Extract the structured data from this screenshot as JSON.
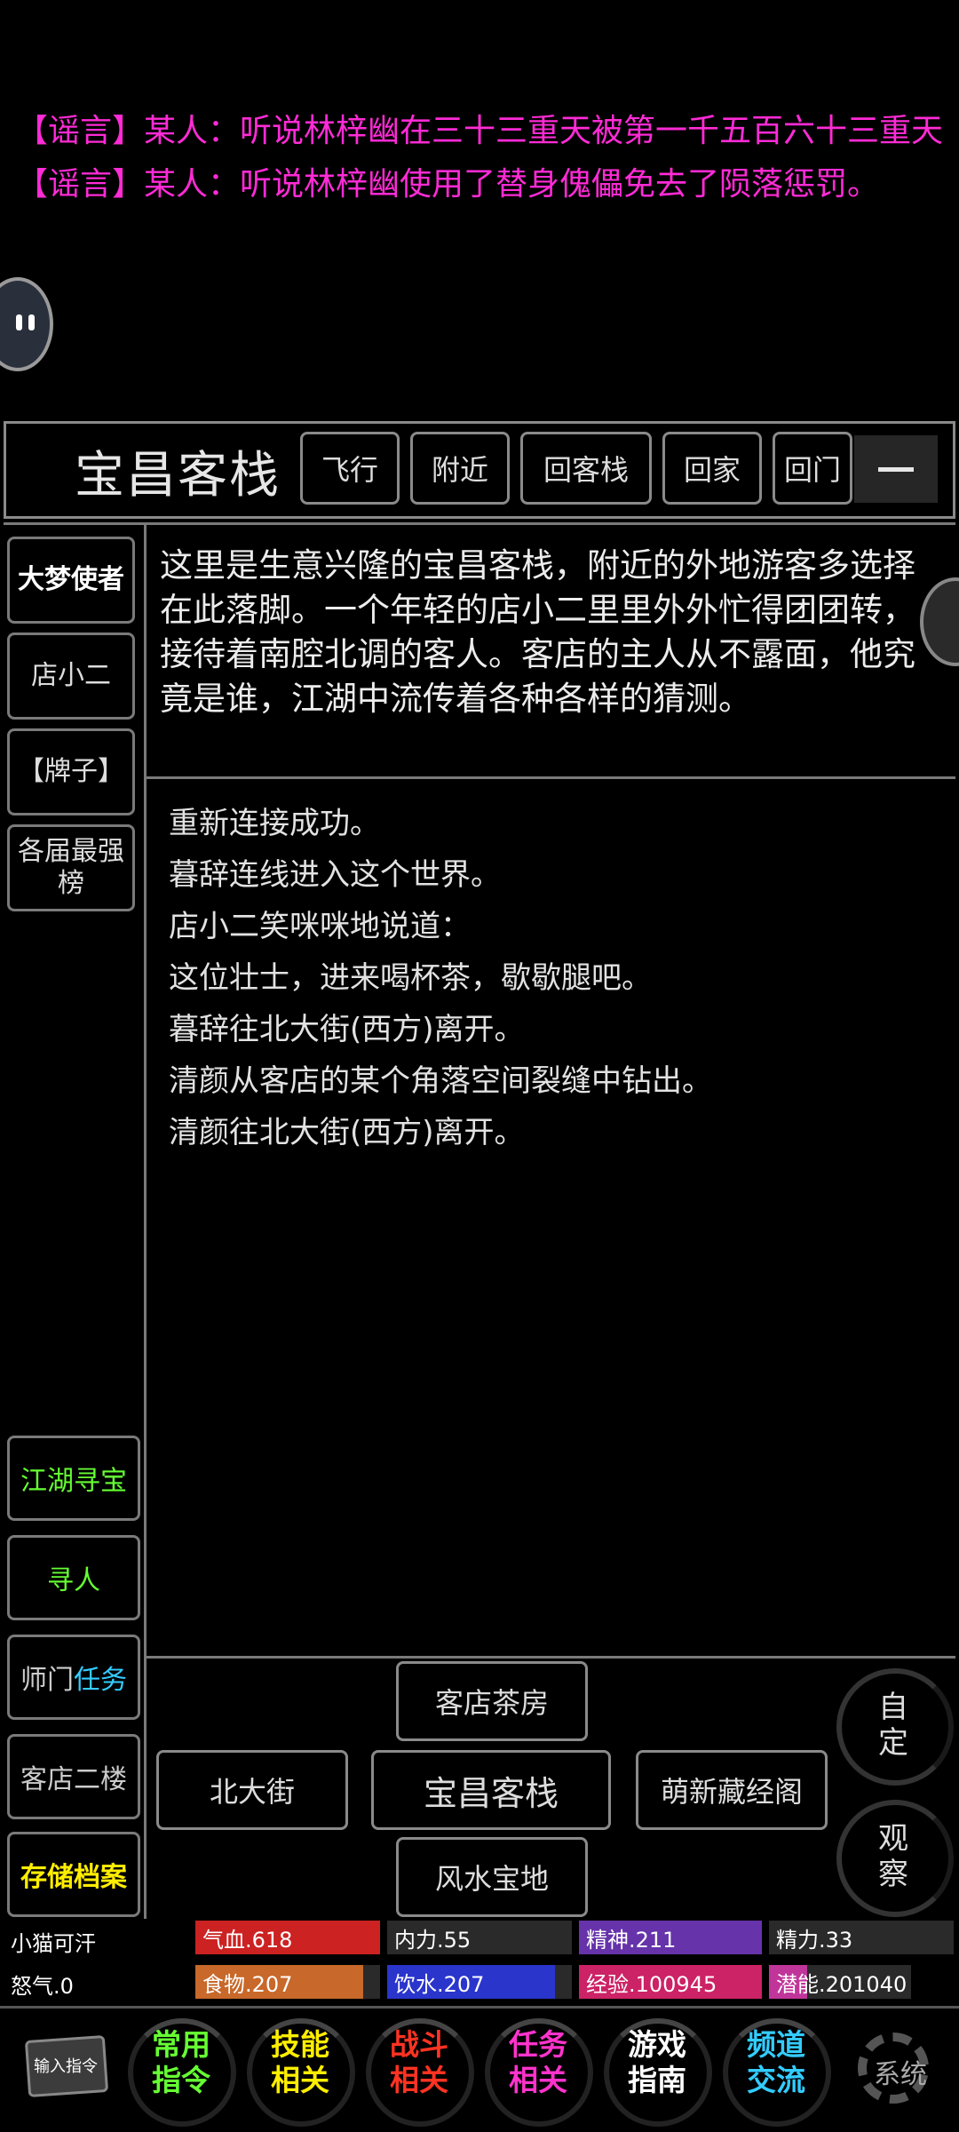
{
  "rumors": [
    "【谣言】某人：听说林梓幽在三十三重天被第一千五百六十三重天",
    "【谣言】某人：听说林梓幽使用了替身傀儡免去了陨落惩罚。"
  ],
  "topbar": {
    "room_title": "宝昌客栈",
    "buttons": [
      "飞行",
      "附近",
      "回客栈",
      "回家",
      "回门"
    ]
  },
  "npcs": [
    "大梦使者",
    "店小二",
    "【牌子】",
    "各届最强榜"
  ],
  "functions": [
    {
      "label": "江湖寻宝",
      "color": "#66ff33"
    },
    {
      "label": "寻人",
      "color": "#66ff33"
    },
    {
      "label_a": "师门",
      "label_b": "任务",
      "color": "#cccccc",
      "color_b": "#33ccff"
    },
    {
      "label": "客店二楼",
      "color": "#cccccc"
    },
    {
      "label": "存储档案",
      "color": "#ffee00"
    }
  ],
  "room_description": "这里是生意兴隆的宝昌客栈，附近的外地游客多选择在此落脚。一个年轻的店小二里里外外忙得团团转，接待着南腔北调的客人。客店的主人从不露面，他究竟是谁，江湖中流传着各种各样的猜测。",
  "messages": [
    "重新连接成功。",
    "暮辞连线进入这个世界。",
    "店小二笑咪咪地说道：",
    "这位壮士，进来喝杯茶，歇歇腿吧。",
    "暮辞往北大街(西方)离开。",
    "清颜从客店的某个角落空间裂缝中钻出。",
    "清颜往北大街(西方)离开。"
  ],
  "exits": {
    "north": "客店茶房",
    "west": "北大街",
    "center": "宝昌客栈",
    "east": "萌新藏经阁",
    "south": "风水宝地"
  },
  "side_buttons": {
    "custom": "自\n定",
    "observe": "观\n察"
  },
  "status": {
    "player_name": "小猫可汗",
    "rage": "怒气.0",
    "bars": [
      {
        "label": "气血.618",
        "fill": 1.0,
        "color": "#cc2222"
      },
      {
        "label": "内力.55",
        "fill": 0.0,
        "color": "#2222cc"
      },
      {
        "label": "精神.211",
        "fill": 1.0,
        "color": "#6633aa"
      },
      {
        "label": "精力.33",
        "fill": 0.0,
        "color": "#227722"
      },
      {
        "label": "食物.207",
        "fill": 0.91,
        "color": "#c8682a"
      },
      {
        "label": "饮水.207",
        "fill": 0.91,
        "color": "#2a35cc"
      },
      {
        "label": "经验.100945",
        "fill": 1.0,
        "color": "#cc2266"
      },
      {
        "label": "潜能.201040",
        "fill": 0.27,
        "color": "#c0359a"
      }
    ]
  },
  "bottom_nav": {
    "input_cmd": "输入指令",
    "items": [
      {
        "l1": "常用",
        "l2": "指令",
        "color": "#66ff33"
      },
      {
        "l1": "技能",
        "l2": "相关",
        "color": "#ffee00"
      },
      {
        "l1": "战斗",
        "l2": "相关",
        "color": "#ff3322"
      },
      {
        "l1": "任务",
        "l2": "相关",
        "color": "#ff33cc"
      },
      {
        "l1": "游戏",
        "l2": "指南",
        "color": "#ffffff"
      },
      {
        "l1": "频道",
        "l2": "交流",
        "color": "#33ccff"
      }
    ],
    "settings": "系统"
  }
}
